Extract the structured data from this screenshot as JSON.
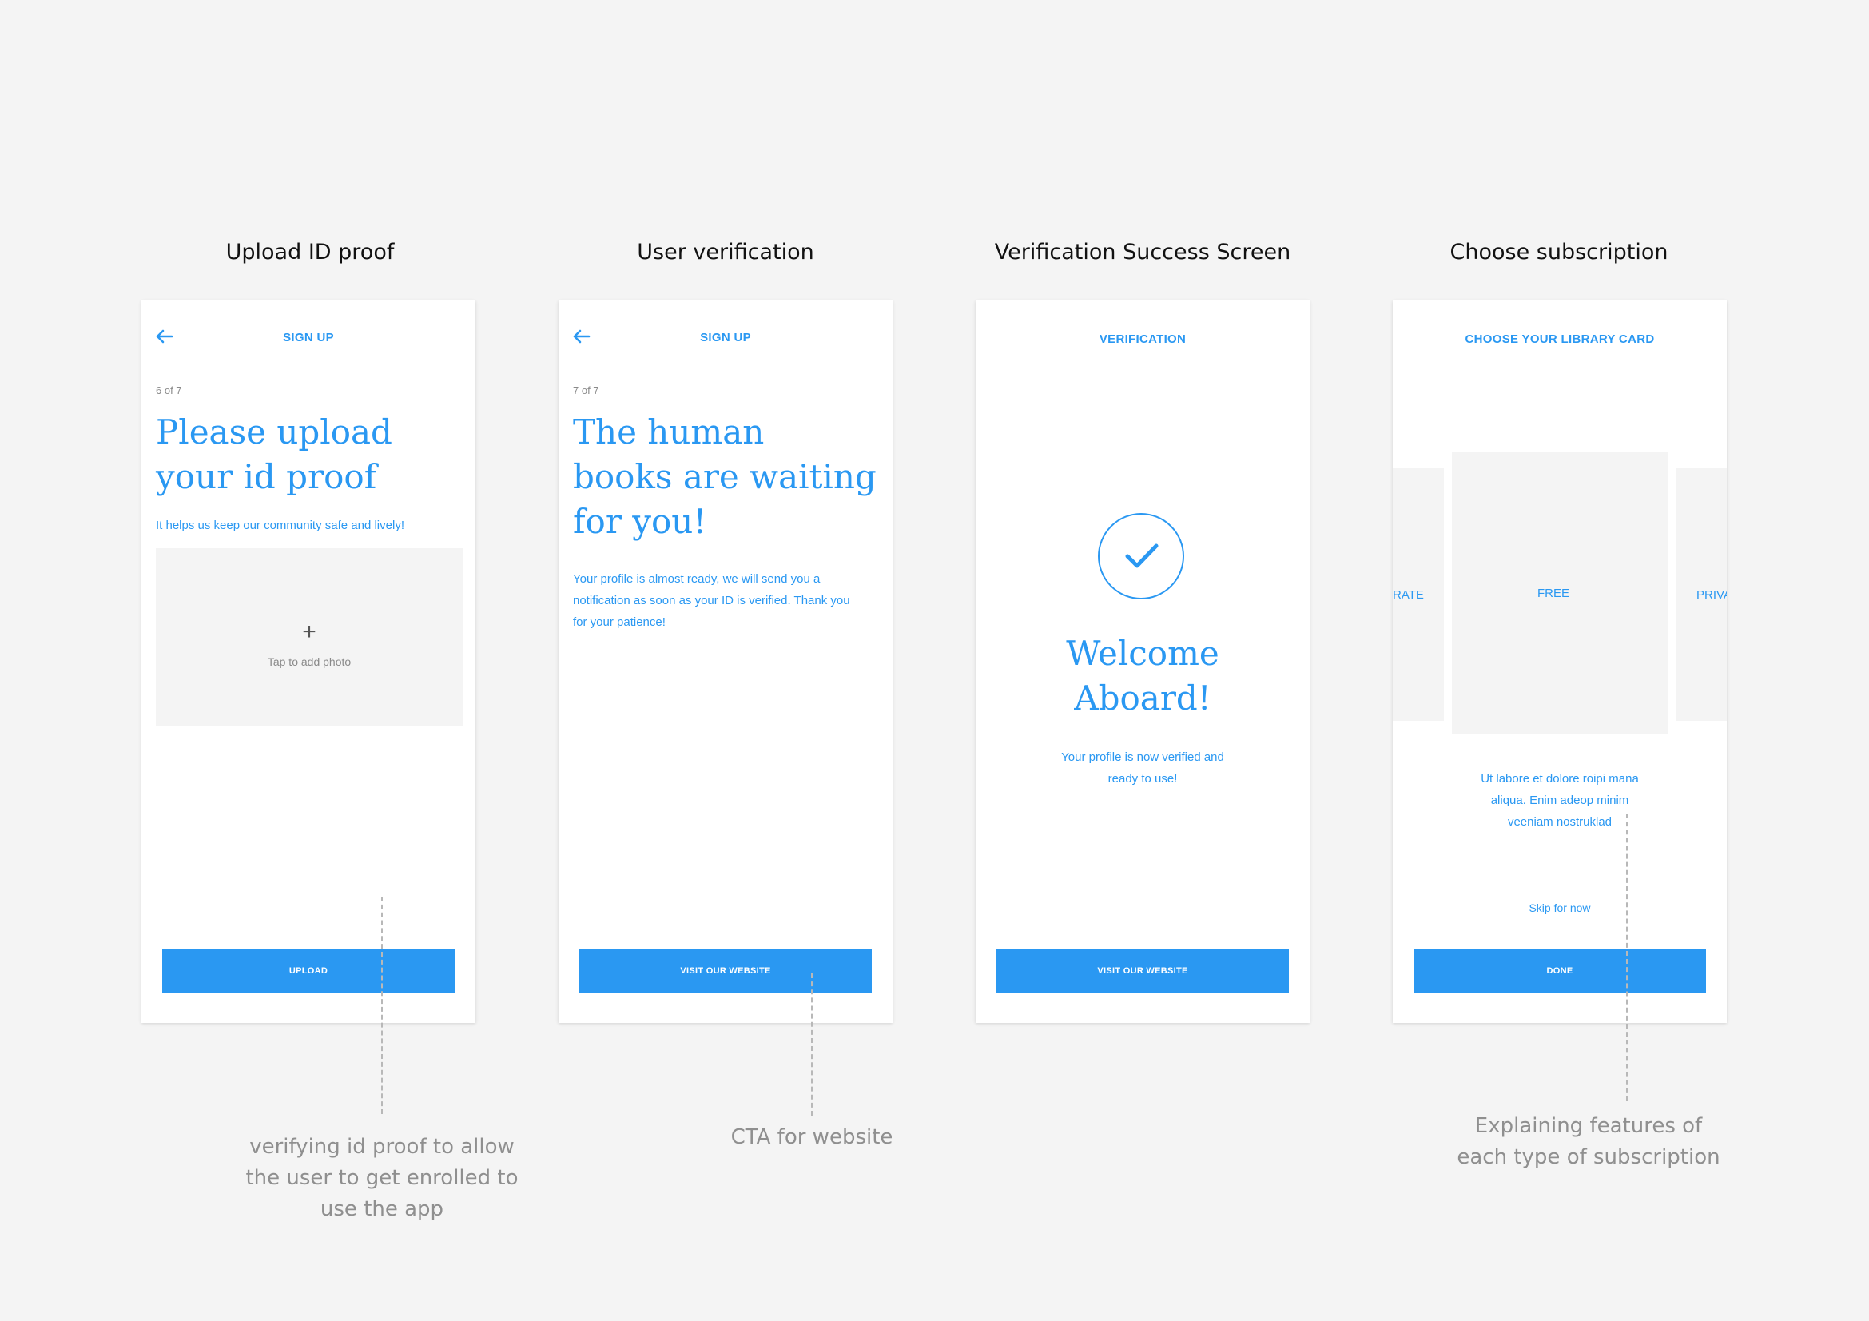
{
  "screens": [
    {
      "title": "Upload ID proof",
      "header": "SIGN UP",
      "step": "6 of 7",
      "headline": [
        "Please upload",
        "your id proof"
      ],
      "subtext": "It helps us keep our community safe and lively!",
      "upload": {
        "icon": "plus-icon",
        "label": "Tap to add photo"
      },
      "button": "UPLOAD"
    },
    {
      "title": "User verification",
      "header": "SIGN UP",
      "step": "7 of 7",
      "headline": [
        "The human",
        "books are waiting",
        "for you!"
      ],
      "body": [
        "Your profile is almost ready, we will send you a",
        "notification as soon as your ID is verified. Thank you",
        "for your patience!"
      ],
      "button": "VISIT OUR WEBSITE"
    },
    {
      "title": "Verification Success Screen",
      "header": "VERIFICATION",
      "icon": "checkmark-circle-icon",
      "headline": [
        "Welcome",
        "Aboard!"
      ],
      "body": [
        "Your profile is now verified and",
        "ready to use!"
      ],
      "button": "VISIT OUR WEBSITE"
    },
    {
      "title": "Choose subscription",
      "header": "CHOOSE YOUR LIBRARY CARD",
      "cards": {
        "left": "RATE",
        "center": "FREE",
        "right": "PRIVA"
      },
      "description": [
        "Ut labore et dolore roipi mana",
        "aliqua. Enim adeop minim",
        "veeniam nostruklad"
      ],
      "skip": "Skip for now",
      "button": "DONE"
    }
  ],
  "annotations": [
    [
      "verifying id proof to allow",
      "the user to get enrolled to",
      "use the app"
    ],
    [
      "CTA for website"
    ],
    [
      "Explaining features of",
      "each type of subscription"
    ]
  ],
  "colors": {
    "accent": "#2a98f2",
    "background": "#f4f4f4",
    "annotation": "#8f8f8f"
  }
}
